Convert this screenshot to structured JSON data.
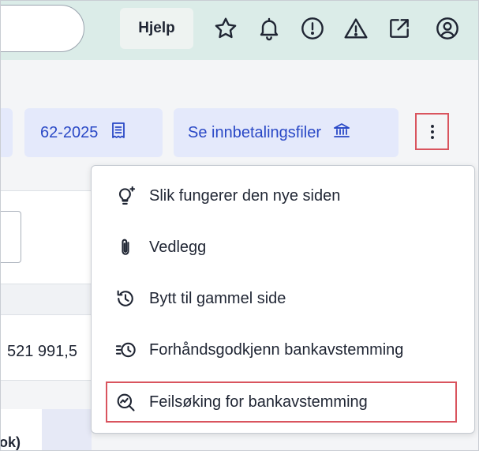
{
  "header": {
    "help_label": "Hjelp",
    "icons": [
      "star-icon",
      "bell-icon",
      "alert-circle-icon",
      "warning-triangle-icon",
      "external-link-icon",
      "user-circle-icon"
    ]
  },
  "toolbar": {
    "chip_period": "62-2025",
    "chip_payment_files": "Se innbetalingsfiler"
  },
  "background": {
    "amount": "521 991,5",
    "column_header": "ok)"
  },
  "menu": {
    "items": [
      {
        "label": "Slik fungerer den nye siden",
        "icon": "lightbulb-sparkle-icon"
      },
      {
        "label": "Vedlegg",
        "icon": "paperclip-icon"
      },
      {
        "label": "Bytt til gammel side",
        "icon": "history-icon"
      },
      {
        "label": "Forhåndsgodkjenn bankavstemming",
        "icon": "list-clock-icon"
      },
      {
        "label": "Feilsøking for bankavstemming",
        "icon": "search-chart-icon"
      }
    ]
  },
  "colors": {
    "header_bg": "#dbece8",
    "chip_bg": "#e4e9fb",
    "chip_text": "#2948c6",
    "highlight_border": "#d9545e"
  }
}
